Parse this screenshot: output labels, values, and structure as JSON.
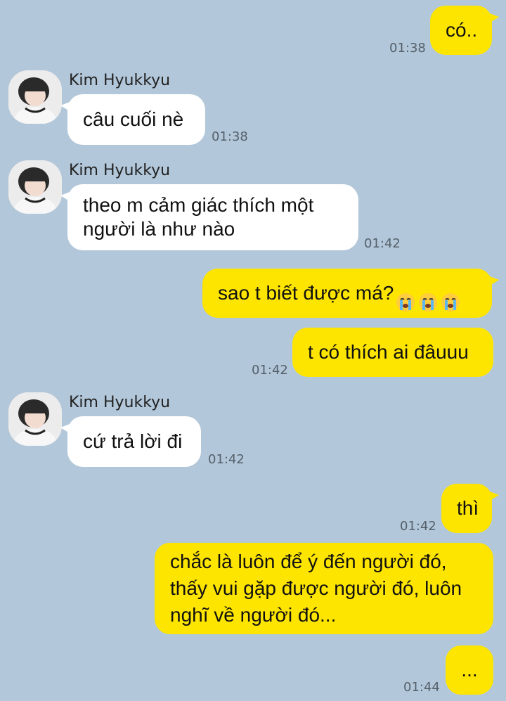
{
  "contact": {
    "name": "Kim Hyukkyu"
  },
  "colors": {
    "background": "#b2c7d9",
    "mine": "#fee500",
    "theirs": "#ffffff"
  },
  "messages": [
    {
      "side": "mine",
      "text": "có..",
      "time": "01:38"
    },
    {
      "side": "theirs",
      "sender": "Kim Hyukkyu",
      "text": "câu cuối nè",
      "time": "01:38"
    },
    {
      "side": "theirs",
      "sender": "Kim Hyukkyu",
      "text": "theo m cảm giác thích một\nngười là như nào",
      "time": "01:42"
    },
    {
      "side": "mine",
      "text": "sao t biết được má?",
      "emoji": "loudly-crying-face-icon x3",
      "time": ""
    },
    {
      "side": "mine",
      "text": "t có thích ai đâuuu",
      "time": "01:42"
    },
    {
      "side": "theirs",
      "sender": "Kim Hyukkyu",
      "text": "cứ trả lời đi",
      "time": "01:42"
    },
    {
      "side": "mine",
      "text": "thì",
      "time": "01:42"
    },
    {
      "side": "mine",
      "text": "chắc là luôn để ý đến người đó,\nthấy vui gặp được người đó, luôn\nnghĩ về người đó...",
      "time": ""
    },
    {
      "side": "mine",
      "text": "...",
      "time": "01:44"
    }
  ]
}
